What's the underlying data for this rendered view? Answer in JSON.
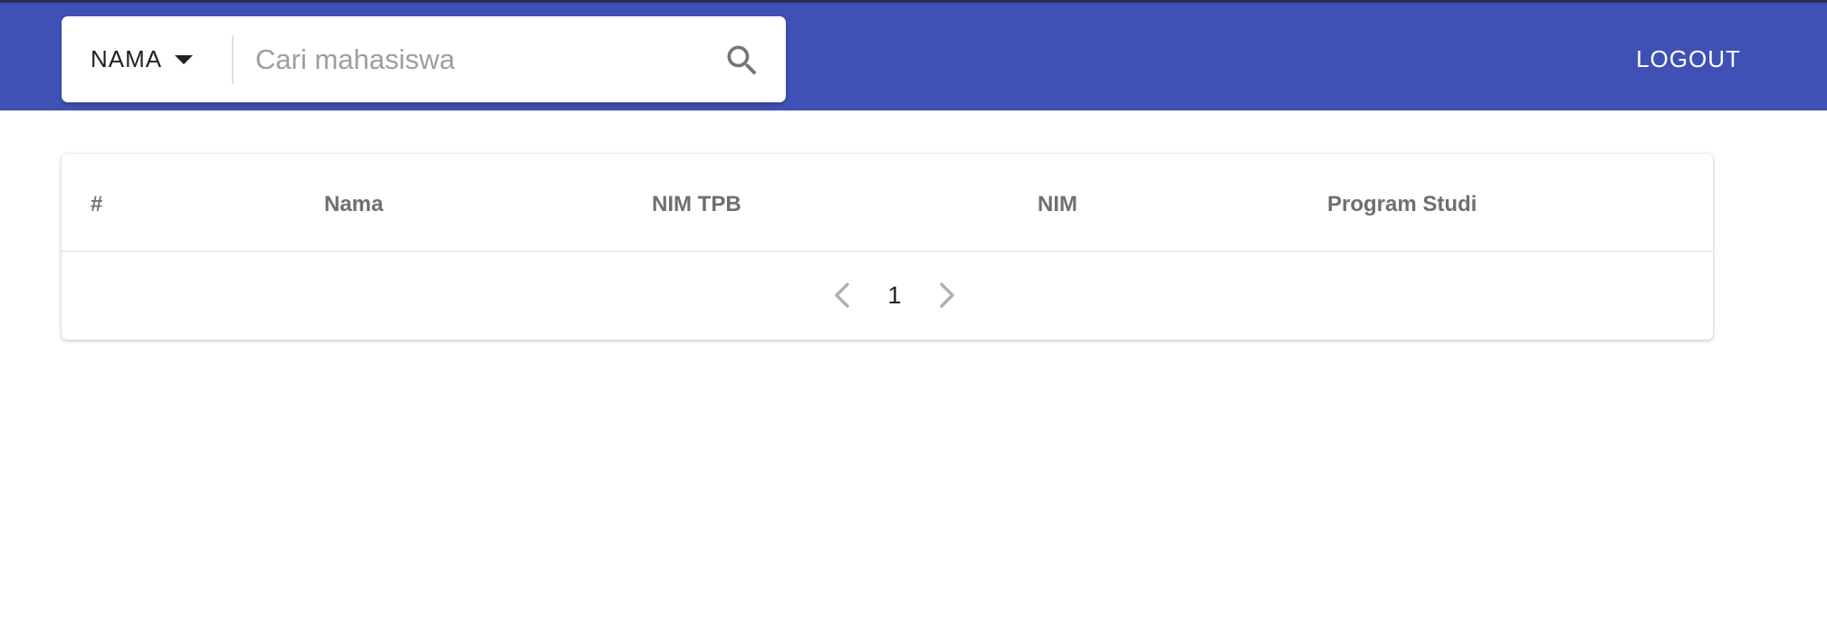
{
  "header": {
    "filter": {
      "selected": "NAMA"
    },
    "search": {
      "placeholder": "Cari mahasiswa",
      "value": ""
    },
    "logout_label": "LOGOUT",
    "colors": {
      "appbar": "#3f51b5",
      "text_on_appbar": "#ffffff"
    }
  },
  "table": {
    "columns": [
      "#",
      "Nama",
      "NIM TPB",
      "NIM",
      "Program Studi"
    ],
    "rows": []
  },
  "pagination": {
    "current_page": "1",
    "prev_icon": "chevron-left-icon",
    "next_icon": "chevron-right-icon"
  },
  "icons": {
    "search": "search-icon",
    "dropdown": "caret-down-icon"
  }
}
